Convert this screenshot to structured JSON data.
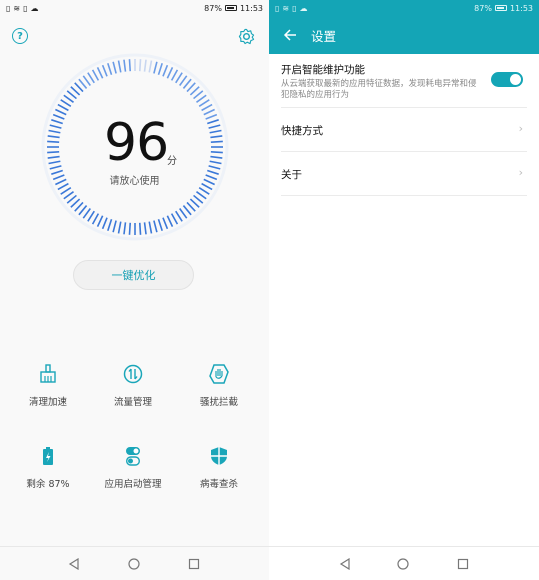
{
  "status_left": {
    "battery_pct": "87%",
    "time": "11:53"
  },
  "status_right": {
    "battery_pct": "87%",
    "time": "11:53"
  },
  "home": {
    "score": "96",
    "score_unit": "分",
    "score_message": "请放心使用",
    "dial_fill_fraction": 0.96,
    "optimize_label": "一键优化",
    "tools": [
      {
        "label": "清理加速",
        "icon": "broom-icon"
      },
      {
        "label": "流量管理",
        "icon": "data-traffic-icon"
      },
      {
        "label": "骚扰拦截",
        "icon": "hand-block-icon"
      },
      {
        "label": "剩余 87%",
        "icon": "battery-icon"
      },
      {
        "label": "应用启动管理",
        "icon": "app-launch-toggle-icon"
      },
      {
        "label": "病毒查杀",
        "icon": "shield-icon"
      }
    ]
  },
  "settings": {
    "title": "设置",
    "rows": [
      {
        "title": "开启智能维护功能",
        "desc": "从云端获取最新的应用特征数据，发现耗电异常和侵犯隐私的应用行为",
        "toggle_on": true
      },
      {
        "title": "快捷方式"
      },
      {
        "title": "关于"
      }
    ]
  },
  "colors": {
    "accent": "#14a5b6",
    "dial_faint": "#c8d6f0",
    "dial_strong": "#3b78d8"
  }
}
